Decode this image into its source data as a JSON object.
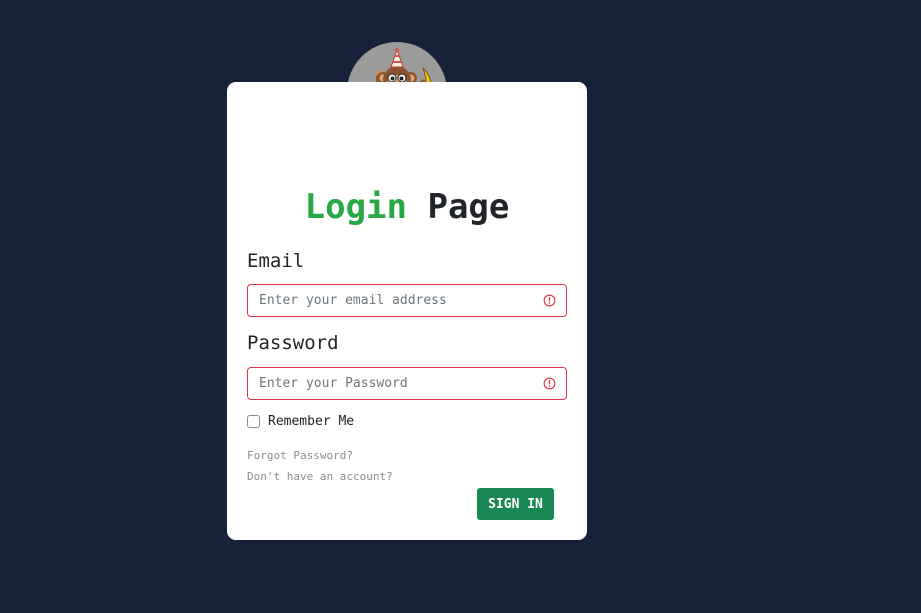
{
  "title": {
    "accent": "Login",
    "rest": "Page"
  },
  "email": {
    "label": "Email",
    "placeholder": "Enter your email address",
    "value": ""
  },
  "password": {
    "label": "Password",
    "placeholder": "Enter your Password",
    "value": ""
  },
  "remember": {
    "label": "Remember Me",
    "checked": false
  },
  "links": {
    "forgot": "Forgot Password?",
    "signup": "Don't have an account?"
  },
  "submit_label": "SIGN IN",
  "colors": {
    "background": "#18213a",
    "accent": "#28a745",
    "error": "#dc3545",
    "button": "#198754",
    "avatar_bg": "#9b9b9b"
  },
  "icons": {
    "avatar": "monkey-mascot-icon",
    "field_error": "exclamation-circle-icon"
  }
}
